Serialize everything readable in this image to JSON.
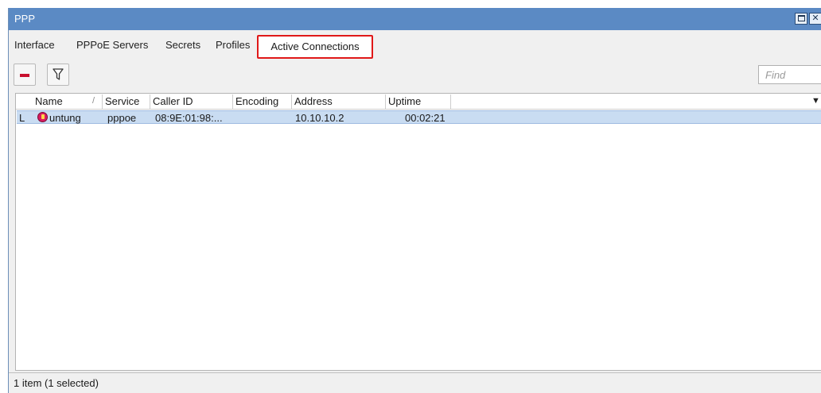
{
  "window": {
    "title": "PPP"
  },
  "tabs": [
    {
      "label": "Interface"
    },
    {
      "label": "PPPoE Servers"
    },
    {
      "label": "Secrets"
    },
    {
      "label": "Profiles"
    },
    {
      "label": "Active Connections",
      "active": true
    }
  ],
  "toolbar": {
    "remove_icon": "minus-icon",
    "filter_icon": "filter-icon",
    "find_placeholder": "Find"
  },
  "table": {
    "columns": [
      "Name",
      "Service",
      "Caller ID",
      "Encoding",
      "Address",
      "Uptime"
    ],
    "sort_indicator": "/",
    "rows": [
      {
        "flag": "L",
        "icon": "user-connection-icon",
        "name": "untung",
        "service": "pppoe",
        "caller_id": "08:9E:01:98:...",
        "encoding": "",
        "address": "10.10.10.2",
        "uptime": "00:02:21",
        "selected": true
      }
    ]
  },
  "status": {
    "text": "1 item (1 selected)"
  },
  "colors": {
    "titlebar": "#5b8ac4",
    "active_tab_highlight": "#e01818",
    "selected_row": "#c9dcf2",
    "remove_button": "#c8102e"
  }
}
